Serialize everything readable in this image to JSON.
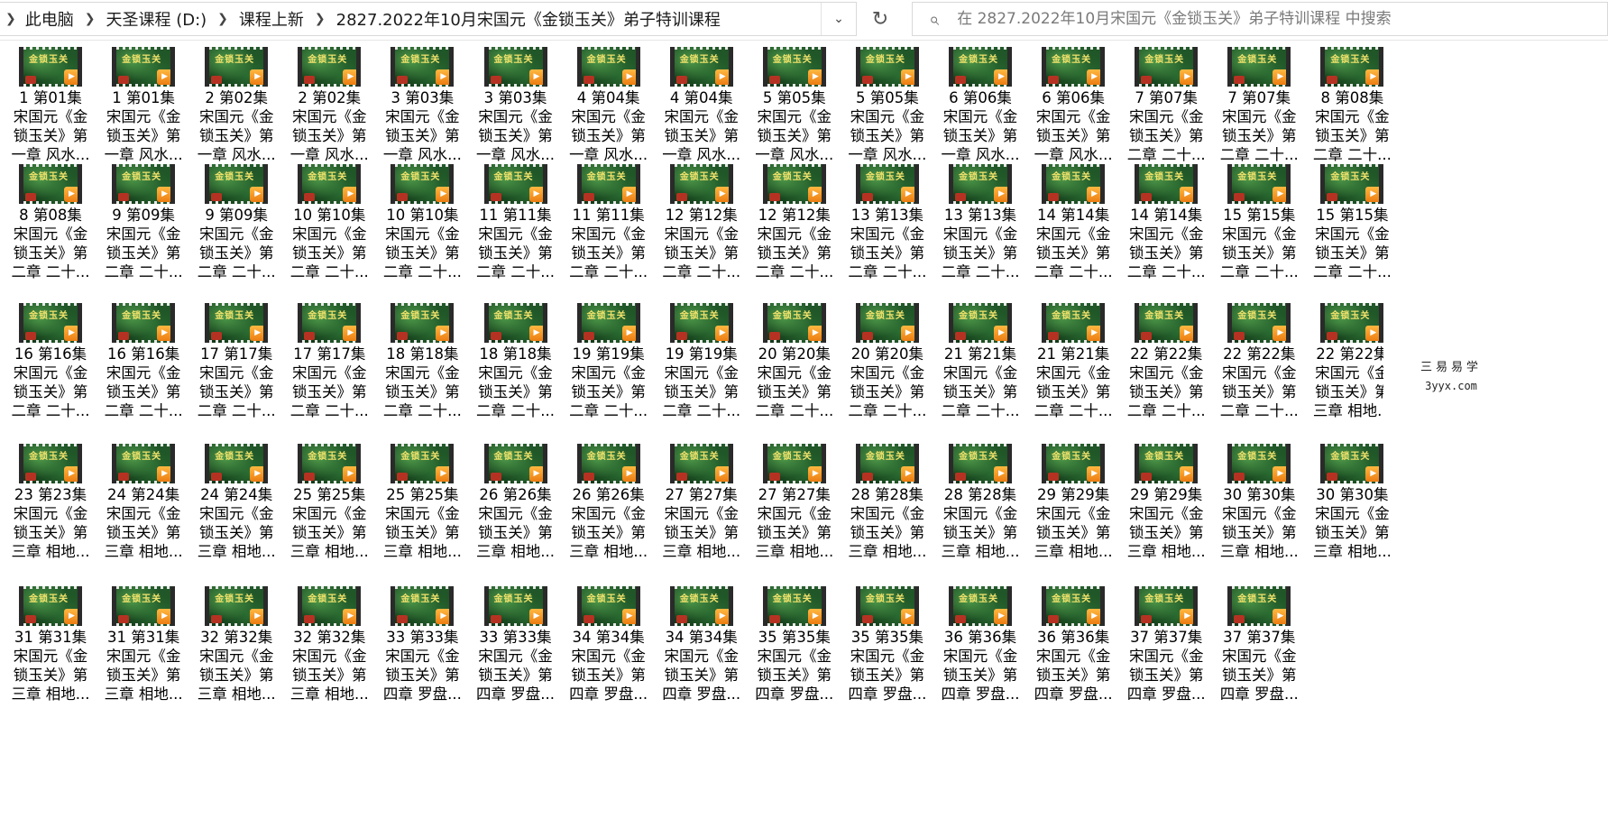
{
  "breadcrumb": {
    "items": [
      "此电脑",
      "天圣课程 (D:)",
      "课程上新",
      "2827.2022年10月宋国元《金锁玉关》弟子特训课程"
    ]
  },
  "search": {
    "placeholder": "在 2827.2022年10月宋国元《金锁玉关》弟子特训课程 中搜索"
  },
  "thumbnail_title": "金锁玉关",
  "watermark": {
    "cn": "三易易学",
    "en": "3yyx.com"
  },
  "rows": [
    [
      [
        "1 第01集",
        "宋国元《金",
        "锁玉关》第",
        "一章 风水..."
      ],
      [
        "1 第01集",
        "宋国元《金",
        "锁玉关》第",
        "一章 风水..."
      ],
      [
        "2 第02集",
        "宋国元《金",
        "锁玉关》第",
        "一章 风水..."
      ],
      [
        "2 第02集",
        "宋国元《金",
        "锁玉关》第",
        "一章 风水..."
      ],
      [
        "3 第03集",
        "宋国元《金",
        "锁玉关》第",
        "一章 风水..."
      ],
      [
        "3 第03集",
        "宋国元《金",
        "锁玉关》第",
        "一章 风水..."
      ],
      [
        "4 第04集",
        "宋国元《金",
        "锁玉关》第",
        "一章 风水..."
      ],
      [
        "4 第04集",
        "宋国元《金",
        "锁玉关》第",
        "一章 风水..."
      ],
      [
        "5 第05集",
        "宋国元《金",
        "锁玉关》第",
        "一章 风水..."
      ],
      [
        "5 第05集",
        "宋国元《金",
        "锁玉关》第",
        "一章 风水..."
      ],
      [
        "6 第06集",
        "宋国元《金",
        "锁玉关》第",
        "一章 风水..."
      ],
      [
        "6 第06集",
        "宋国元《金",
        "锁玉关》第",
        "一章 风水..."
      ],
      [
        "7 第07集",
        "宋国元《金",
        "锁玉关》第",
        "二章 二十..."
      ],
      [
        "7 第07集",
        "宋国元《金",
        "锁玉关》第",
        "二章 二十..."
      ],
      [
        "8 第08集",
        "宋国元《金",
        "锁玉关》第",
        "二章 二十..."
      ]
    ],
    [
      [
        "8 第08集",
        "宋国元《金",
        "锁玉关》第",
        "二章 二十..."
      ],
      [
        "9 第09集",
        "宋国元《金",
        "锁玉关》第",
        "二章 二十..."
      ],
      [
        "9 第09集",
        "宋国元《金",
        "锁玉关》第",
        "二章 二十..."
      ],
      [
        "10 第10集",
        "宋国元《金",
        "锁玉关》第",
        "二章 二十..."
      ],
      [
        "10 第10集",
        "宋国元《金",
        "锁玉关》第",
        "二章 二十..."
      ],
      [
        "11 第11集",
        "宋国元《金",
        "锁玉关》第",
        "二章 二十..."
      ],
      [
        "11 第11集",
        "宋国元《金",
        "锁玉关》第",
        "二章 二十..."
      ],
      [
        "12 第12集",
        "宋国元《金",
        "锁玉关》第",
        "二章 二十..."
      ],
      [
        "12 第12集",
        "宋国元《金",
        "锁玉关》第",
        "二章 二十..."
      ],
      [
        "13 第13集",
        "宋国元《金",
        "锁玉关》第",
        "二章 二十..."
      ],
      [
        "13 第13集",
        "宋国元《金",
        "锁玉关》第",
        "二章 二十..."
      ],
      [
        "14 第14集",
        "宋国元《金",
        "锁玉关》第",
        "二章 二十..."
      ],
      [
        "14 第14集",
        "宋国元《金",
        "锁玉关》第",
        "二章 二十..."
      ],
      [
        "15 第15集",
        "宋国元《金",
        "锁玉关》第",
        "二章 二十..."
      ],
      [
        "15 第15集",
        "宋国元《金",
        "锁玉关》第",
        "二章 二十..."
      ]
    ],
    [
      [
        "16 第16集",
        "宋国元《金",
        "锁玉关》第",
        "二章 二十..."
      ],
      [
        "16 第16集",
        "宋国元《金",
        "锁玉关》第",
        "二章 二十..."
      ],
      [
        "17 第17集",
        "宋国元《金",
        "锁玉关》第",
        "二章 二十..."
      ],
      [
        "17 第17集",
        "宋国元《金",
        "锁玉关》第",
        "二章 二十..."
      ],
      [
        "18 第18集",
        "宋国元《金",
        "锁玉关》第",
        "二章 二十..."
      ],
      [
        "18 第18集",
        "宋国元《金",
        "锁玉关》第",
        "二章 二十..."
      ],
      [
        "19 第19集",
        "宋国元《金",
        "锁玉关》第",
        "二章 二十..."
      ],
      [
        "19 第19集",
        "宋国元《金",
        "锁玉关》第",
        "二章 二十..."
      ],
      [
        "20 第20集",
        "宋国元《金",
        "锁玉关》第",
        "二章 二十..."
      ],
      [
        "20 第20集",
        "宋国元《金",
        "锁玉关》第",
        "二章 二十..."
      ],
      [
        "21 第21集",
        "宋国元《金",
        "锁玉关》第",
        "二章 二十..."
      ],
      [
        "21 第21集",
        "宋国元《金",
        "锁玉关》第",
        "二章 二十..."
      ],
      [
        "22 第22集",
        "宋国元《金",
        "锁玉关》第",
        "二章 二十..."
      ],
      [
        "22 第22集",
        "宋国元《金",
        "锁玉关》第",
        "二章 二十..."
      ],
      [
        "22 第22集",
        "宋国元《金",
        "锁玉关》第",
        "三章 相地..."
      ]
    ],
    [
      [
        "23 第23集",
        "宋国元《金",
        "锁玉关》第",
        "三章 相地..."
      ],
      [
        "24 第24集",
        "宋国元《金",
        "锁玉关》第",
        "三章 相地..."
      ],
      [
        "24 第24集",
        "宋国元《金",
        "锁玉关》第",
        "三章 相地..."
      ],
      [
        "25 第25集",
        "宋国元《金",
        "锁玉关》第",
        "三章 相地..."
      ],
      [
        "25 第25集",
        "宋国元《金",
        "锁玉关》第",
        "三章 相地..."
      ],
      [
        "26 第26集",
        "宋国元《金",
        "锁玉关》第",
        "三章 相地..."
      ],
      [
        "26 第26集",
        "宋国元《金",
        "锁玉关》第",
        "三章 相地..."
      ],
      [
        "27 第27集",
        "宋国元《金",
        "锁玉关》第",
        "三章 相地..."
      ],
      [
        "27 第27集",
        "宋国元《金",
        "锁玉关》第",
        "三章 相地..."
      ],
      [
        "28 第28集",
        "宋国元《金",
        "锁玉关》第",
        "三章 相地..."
      ],
      [
        "28 第28集",
        "宋国元《金",
        "锁玉关》第",
        "三章 相地..."
      ],
      [
        "29 第29集",
        "宋国元《金",
        "锁玉关》第",
        "三章 相地..."
      ],
      [
        "29 第29集",
        "宋国元《金",
        "锁玉关》第",
        "三章 相地..."
      ],
      [
        "30 第30集",
        "宋国元《金",
        "锁玉关》第",
        "三章 相地..."
      ],
      [
        "30 第30集",
        "宋国元《金",
        "锁玉关》第",
        "三章 相地..."
      ]
    ],
    [
      [
        "31 第31集",
        "宋国元《金",
        "锁玉关》第",
        "三章 相地..."
      ],
      [
        "31 第31集",
        "宋国元《金",
        "锁玉关》第",
        "三章 相地..."
      ],
      [
        "32 第32集",
        "宋国元《金",
        "锁玉关》第",
        "三章 相地..."
      ],
      [
        "32 第32集",
        "宋国元《金",
        "锁玉关》第",
        "三章 相地..."
      ],
      [
        "33 第33集",
        "宋国元《金",
        "锁玉关》第",
        "四章 罗盘..."
      ],
      [
        "33 第33集",
        "宋国元《金",
        "锁玉关》第",
        "四章 罗盘..."
      ],
      [
        "34 第34集",
        "宋国元《金",
        "锁玉关》第",
        "四章 罗盘..."
      ],
      [
        "34 第34集",
        "宋国元《金",
        "锁玉关》第",
        "四章 罗盘..."
      ],
      [
        "35 第35集",
        "宋国元《金",
        "锁玉关》第",
        "四章 罗盘..."
      ],
      [
        "35 第35集",
        "宋国元《金",
        "锁玉关》第",
        "四章 罗盘..."
      ],
      [
        "36 第36集",
        "宋国元《金",
        "锁玉关》第",
        "四章 罗盘..."
      ],
      [
        "36 第36集",
        "宋国元《金",
        "锁玉关》第",
        "四章 罗盘..."
      ],
      [
        "37 第37集",
        "宋国元《金",
        "锁玉关》第",
        "四章 罗盘..."
      ],
      [
        "37 第37集",
        "宋国元《金",
        "锁玉关》第",
        "四章 罗盘..."
      ]
    ]
  ]
}
